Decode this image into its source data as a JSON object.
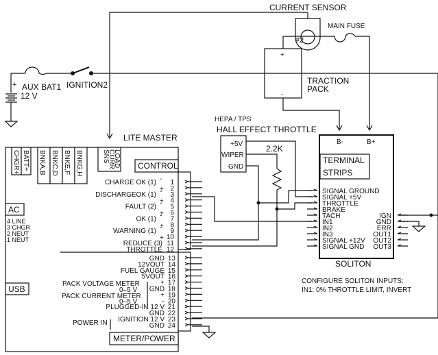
{
  "diagram": {
    "current_sensor": {
      "label": "CURRENT SENSOR",
      "marker": "#2"
    },
    "main_fuse": {
      "label": "MAIN FUSE"
    },
    "traction_pack": {
      "label_line1": "TRACTION",
      "label_line2": "PACK",
      "plus": "+",
      "minus": "-"
    },
    "aux_battery": {
      "label": "AUX BAT1",
      "voltage": "12 V",
      "plus": "+"
    },
    "ignition_switch": {
      "label": "IGNITION2"
    },
    "hall_throttle": {
      "subtitle": "HEPA / TPS",
      "title": "HALL EFFECT THROTTLE",
      "pins": [
        "+5V",
        "WIPER",
        "GND"
      ]
    },
    "resistor": {
      "label": "2.2K"
    },
    "lite_master": {
      "title": "LITE MASTER",
      "top_connectors": [
        "CHGR+",
        "BATT+",
        "BNKA,B",
        "BNKC,D",
        "BNKE,F",
        "BNKG,H"
      ],
      "load_sense": [
        "LOAD",
        "CURR",
        "SNS"
      ],
      "ac": {
        "label": "AC",
        "pins": [
          "4  LINE",
          "3  CHGR",
          "2  NEUT",
          "1  NEUT"
        ]
      },
      "usb": {
        "label": "USB"
      },
      "control": {
        "label": "CONTROL",
        "rows": [
          {
            "name": "CHARGE OK (1)",
            "sign": "-",
            "pin": "1"
          },
          {
            "name": "",
            "sign": "+",
            "pin": "2"
          },
          {
            "name": "DISCHARGEOK (1)",
            "sign": "-",
            "pin": "3"
          },
          {
            "name": "",
            "sign": "+",
            "pin": "4"
          },
          {
            "name": "FAULT (2)",
            "sign": "-",
            "pin": "5"
          },
          {
            "name": "",
            "sign": "+",
            "pin": "6"
          },
          {
            "name": "OK (1)",
            "sign": "-",
            "pin": "7"
          },
          {
            "name": "",
            "sign": "+",
            "pin": "8"
          },
          {
            "name": "WARNING (1)",
            "sign": "-",
            "pin": "9"
          },
          {
            "name": "",
            "sign": "+",
            "pin": "10"
          },
          {
            "name": "REDUCE (3)",
            "sign": "",
            "pin": "11"
          },
          {
            "name": "THROTTLE",
            "sign": "",
            "pin": "12"
          }
        ]
      },
      "meter_power": {
        "label": "METER/POWER",
        "rows": [
          {
            "name": "GND",
            "pin": "13"
          },
          {
            "name": "12VOUT",
            "pin": "14"
          },
          {
            "name": "FUEL GAUGE",
            "pin": "15"
          },
          {
            "name": "5VOUT",
            "pin": "16"
          },
          {
            "name": "+",
            "pin": "17"
          },
          {
            "name": "GND",
            "pin": "18"
          },
          {
            "name": "+",
            "pin": "19"
          },
          {
            "name": "-",
            "pin": "20"
          },
          {
            "name": "PLUGGED-IN 12 V",
            "pin": "21"
          },
          {
            "name": "GND",
            "pin": "22"
          },
          {
            "name": "IGNITION 12 V",
            "pin": "23"
          },
          {
            "name": "GND",
            "pin": "24"
          }
        ],
        "group_labels": {
          "pack_voltage": "PACK VOLTAGE METER",
          "pack_voltage_range": "0–5 V",
          "pack_current": "PACK CURRENT METER",
          "pack_current_range": "0–5 V",
          "power_in": "POWER IN"
        }
      }
    },
    "soliton": {
      "title": "SOLITON",
      "terminals_top": [
        "B-",
        "B+"
      ],
      "terminal_strips_line1": "TERMINAL",
      "terminal_strips_line2": "STRIPS",
      "left_pins": [
        "SIGNAL GROUND",
        "SIGNAL +5V",
        "THROTTLE",
        "BRAKE",
        "TACH",
        "IN1",
        "IN2",
        "IN3",
        "SIGNAL +12V",
        "SIGNAL GND"
      ],
      "right_pins": [
        "IGN",
        "GND",
        "ERR",
        "OUT1",
        "OUT2",
        "OUT3"
      ]
    },
    "note": {
      "line1": "CONFIGURE SOLITON INPUTS:",
      "line2": "IN1: 0% THROTTLE LIMIT, INVERT"
    }
  }
}
